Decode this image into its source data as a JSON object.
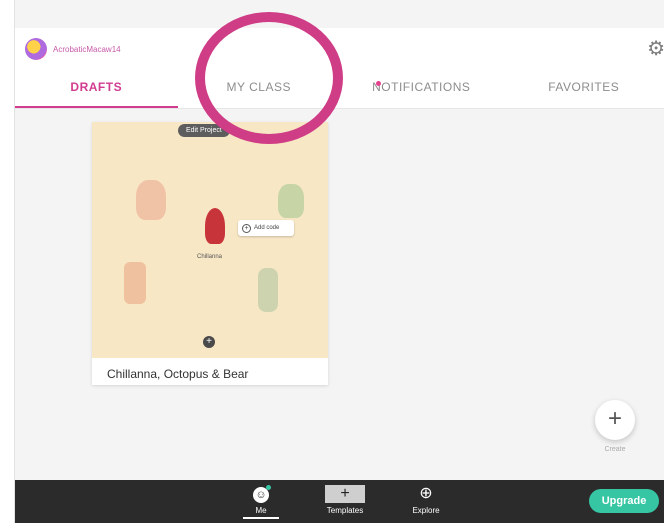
{
  "header": {
    "username": "AcrobaticMacaw14",
    "avatar_icon": "user-avatar",
    "settings_icon": "gear-icon"
  },
  "tabs": [
    {
      "label": "DRAFTS",
      "active": true
    },
    {
      "label": "MY CLASS",
      "active": false
    },
    {
      "label": "NOTIFICATIONS",
      "active": false,
      "has_dot": true
    },
    {
      "label": "FAVORITES",
      "active": false
    }
  ],
  "project": {
    "badge": "Edit Project",
    "character_name": "Chillanna",
    "add_code_label": "Add code",
    "title": "Chillanna, Octopus & Bear"
  },
  "create": {
    "icon": "+",
    "label": "Create"
  },
  "bottom_nav": {
    "items": [
      {
        "label": "Me",
        "icon": "face-icon"
      },
      {
        "label": "Templates",
        "icon": "plus-icon"
      },
      {
        "label": "Explore",
        "icon": "globe-icon"
      }
    ],
    "upgrade_label": "Upgrade"
  },
  "colors": {
    "accent": "#d23c8e",
    "highlight_ring": "#cf3d86",
    "upgrade": "#37c6a4",
    "bottom_bar": "#2b2b2b"
  }
}
